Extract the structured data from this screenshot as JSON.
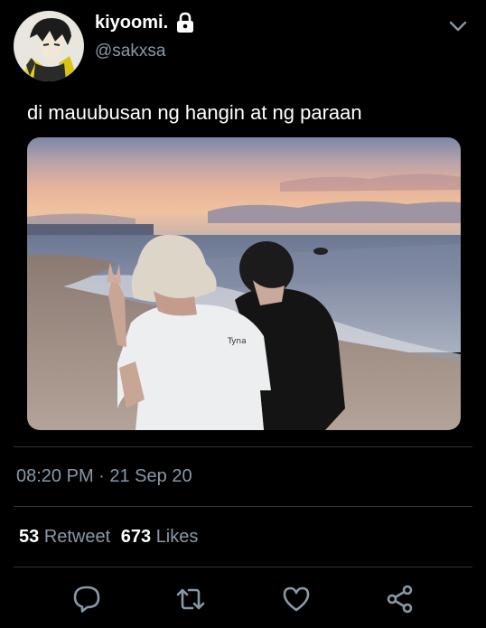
{
  "user": {
    "display_name": "kiyoomi.",
    "handle": "@sakxsa",
    "protected_icon": "lock-icon",
    "avatar": "anime-character-avatar"
  },
  "tweet": {
    "text": "di mauubusan ng hangin at ng paraan",
    "media": "photo-two-people-on-beach-at-sunset",
    "timestamp": "08:20 PM · 21 Sep 20"
  },
  "stats": {
    "retweets_count": "53",
    "retweets_label": "Retweet",
    "likes_count": "673",
    "likes_label": "Likes"
  },
  "actions": [
    {
      "name": "reply",
      "icon": "speech-bubble-icon"
    },
    {
      "name": "retweet",
      "icon": "retweet-arrows-icon"
    },
    {
      "name": "like",
      "icon": "heart-icon"
    },
    {
      "name": "share",
      "icon": "share-icon"
    }
  ],
  "colors": {
    "background": "#000000",
    "primary_text": "#ffffff",
    "secondary_text": "#8899a6",
    "divider": "#2f3336",
    "icon": "#8899a6"
  }
}
